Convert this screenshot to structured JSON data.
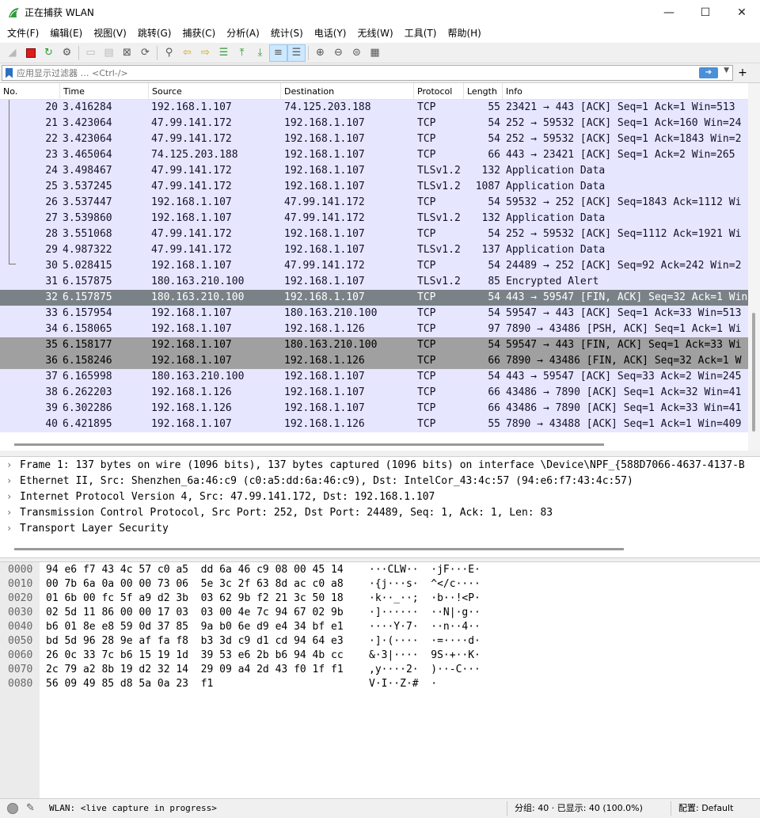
{
  "window": {
    "title": "正在捕获 WLAN",
    "minimize": "—",
    "maximize": "☐",
    "close": "✕"
  },
  "menu": [
    "文件(F)",
    "编辑(E)",
    "视图(V)",
    "跳转(G)",
    "捕获(C)",
    "分析(A)",
    "统计(S)",
    "电话(Y)",
    "无线(W)",
    "工具(T)",
    "帮助(H)"
  ],
  "toolbar": {
    "icons": [
      "start-capture-icon",
      "stop-capture-icon",
      "restart-capture-icon",
      "capture-options-icon",
      "open-file-icon",
      "save-file-icon",
      "close-file-icon",
      "reload-icon",
      "find-packet-icon",
      "go-back-icon",
      "go-forward-icon",
      "go-to-packet-icon",
      "first-packet-icon",
      "last-packet-icon",
      "auto-scroll-icon",
      "colorize-icon",
      "zoom-in-icon",
      "zoom-out-icon",
      "normal-size-icon",
      "resize-columns-icon"
    ]
  },
  "filter": {
    "placeholder": "应用显示过滤器 … <Ctrl-/>",
    "add": "+"
  },
  "packet_list": {
    "columns": [
      "No.",
      "Time",
      "Source",
      "Destination",
      "Protocol",
      "Length",
      "Info"
    ],
    "rows": [
      {
        "no": "20",
        "time": "3.416284",
        "src": "192.168.1.107",
        "dst": "74.125.203.188",
        "proto": "TCP",
        "len": "55",
        "info": "23421 → 443 [ACK] Seq=1 Ack=1 Win=513",
        "style": "normal"
      },
      {
        "no": "21",
        "time": "3.423064",
        "src": "47.99.141.172",
        "dst": "192.168.1.107",
        "proto": "TCP",
        "len": "54",
        "info": "252 → 59532 [ACK] Seq=1 Ack=160 Win=24",
        "style": "normal"
      },
      {
        "no": "22",
        "time": "3.423064",
        "src": "47.99.141.172",
        "dst": "192.168.1.107",
        "proto": "TCP",
        "len": "54",
        "info": "252 → 59532 [ACK] Seq=1 Ack=1843 Win=2",
        "style": "normal"
      },
      {
        "no": "23",
        "time": "3.465064",
        "src": "74.125.203.188",
        "dst": "192.168.1.107",
        "proto": "TCP",
        "len": "66",
        "info": "443 → 23421 [ACK] Seq=1 Ack=2 Win=265",
        "style": "normal"
      },
      {
        "no": "24",
        "time": "3.498467",
        "src": "47.99.141.172",
        "dst": "192.168.1.107",
        "proto": "TLSv1.2",
        "len": "132",
        "info": "Application Data",
        "style": "normal"
      },
      {
        "no": "25",
        "time": "3.537245",
        "src": "47.99.141.172",
        "dst": "192.168.1.107",
        "proto": "TLSv1.2",
        "len": "1087",
        "info": "Application Data",
        "style": "normal"
      },
      {
        "no": "26",
        "time": "3.537447",
        "src": "192.168.1.107",
        "dst": "47.99.141.172",
        "proto": "TCP",
        "len": "54",
        "info": "59532 → 252 [ACK] Seq=1843 Ack=1112 Wi",
        "style": "normal"
      },
      {
        "no": "27",
        "time": "3.539860",
        "src": "192.168.1.107",
        "dst": "47.99.141.172",
        "proto": "TLSv1.2",
        "len": "132",
        "info": "Application Data",
        "style": "normal"
      },
      {
        "no": "28",
        "time": "3.551068",
        "src": "47.99.141.172",
        "dst": "192.168.1.107",
        "proto": "TCP",
        "len": "54",
        "info": "252 → 59532 [ACK] Seq=1112 Ack=1921 Wi",
        "style": "normal"
      },
      {
        "no": "29",
        "time": "4.987322",
        "src": "47.99.141.172",
        "dst": "192.168.1.107",
        "proto": "TLSv1.2",
        "len": "137",
        "info": "Application Data",
        "style": "normal"
      },
      {
        "no": "30",
        "time": "5.028415",
        "src": "192.168.1.107",
        "dst": "47.99.141.172",
        "proto": "TCP",
        "len": "54",
        "info": "24489 → 252 [ACK] Seq=92 Ack=242 Win=2",
        "style": "normal"
      },
      {
        "no": "31",
        "time": "6.157875",
        "src": "180.163.210.100",
        "dst": "192.168.1.107",
        "proto": "TLSv1.2",
        "len": "85",
        "info": "Encrypted Alert",
        "style": "normal"
      },
      {
        "no": "32",
        "time": "6.157875",
        "src": "180.163.210.100",
        "dst": "192.168.1.107",
        "proto": "TCP",
        "len": "54",
        "info": "443 → 59547 [FIN, ACK] Seq=32 Ack=1 Win",
        "style": "fin1"
      },
      {
        "no": "33",
        "time": "6.157954",
        "src": "192.168.1.107",
        "dst": "180.163.210.100",
        "proto": "TCP",
        "len": "54",
        "info": "59547 → 443 [ACK] Seq=1 Ack=33 Win=513",
        "style": "normal"
      },
      {
        "no": "34",
        "time": "6.158065",
        "src": "192.168.1.107",
        "dst": "192.168.1.126",
        "proto": "TCP",
        "len": "97",
        "info": "7890 → 43486 [PSH, ACK] Seq=1 Ack=1 Wi",
        "style": "normal"
      },
      {
        "no": "35",
        "time": "6.158177",
        "src": "192.168.1.107",
        "dst": "180.163.210.100",
        "proto": "TCP",
        "len": "54",
        "info": "59547 → 443 [FIN, ACK] Seq=1 Ack=33 Wi",
        "style": "fin2"
      },
      {
        "no": "36",
        "time": "6.158246",
        "src": "192.168.1.107",
        "dst": "192.168.1.126",
        "proto": "TCP",
        "len": "66",
        "info": "7890 → 43486 [FIN, ACK] Seq=32 Ack=1 W",
        "style": "fin2"
      },
      {
        "no": "37",
        "time": "6.165998",
        "src": "180.163.210.100",
        "dst": "192.168.1.107",
        "proto": "TCP",
        "len": "54",
        "info": "443 → 59547 [ACK] Seq=33 Ack=2 Win=245",
        "style": "normal"
      },
      {
        "no": "38",
        "time": "6.262203",
        "src": "192.168.1.126",
        "dst": "192.168.1.107",
        "proto": "TCP",
        "len": "66",
        "info": "43486 → 7890 [ACK] Seq=1 Ack=32 Win=41",
        "style": "normal"
      },
      {
        "no": "39",
        "time": "6.302286",
        "src": "192.168.1.126",
        "dst": "192.168.1.107",
        "proto": "TCP",
        "len": "66",
        "info": "43486 → 7890 [ACK] Seq=1 Ack=33 Win=41",
        "style": "normal"
      },
      {
        "no": "40",
        "time": "6.421895",
        "src": "192.168.1.107",
        "dst": "192.168.1.126",
        "proto": "TCP",
        "len": "55",
        "info": "7890 → 43488 [ACK] Seq=1 Ack=1 Win=409",
        "style": "normal"
      }
    ]
  },
  "colors": {
    "normal_bg": "#e7e6ff",
    "normal_fg": "#12122a",
    "fin1_bg": "#7a8288",
    "fin1_fg": "#ffffff",
    "fin2_bg": "#a0a0a0",
    "fin2_fg": "#000000"
  },
  "details": [
    "Frame 1: 137 bytes on wire (1096 bits), 137 bytes captured (1096 bits) on interface \\Device\\NPF_{588D7066-4637-4137-B",
    "Ethernet II, Src: Shenzhen_6a:46:c9 (c0:a5:dd:6a:46:c9), Dst: IntelCor_43:4c:57 (94:e6:f7:43:4c:57)",
    "Internet Protocol Version 4, Src: 47.99.141.172, Dst: 192.168.1.107",
    "Transmission Control Protocol, Src Port: 252, Dst Port: 24489, Seq: 1, Ack: 1, Len: 83",
    "Transport Layer Security"
  ],
  "bytes": [
    {
      "off": "0000",
      "hex": "94 e6 f7 43 4c 57 c0 a5  dd 6a 46 c9 08 00 45 14",
      "ascii": "···CLW··  ·jF···E·"
    },
    {
      "off": "0010",
      "hex": "00 7b 6a 0a 00 00 73 06  5e 3c 2f 63 8d ac c0 a8",
      "ascii": "·{j···s·  ^</c····"
    },
    {
      "off": "0020",
      "hex": "01 6b 00 fc 5f a9 d2 3b  03 62 9b f2 21 3c 50 18",
      "ascii": "·k··_··;  ·b··!<P·"
    },
    {
      "off": "0030",
      "hex": "02 5d 11 86 00 00 17 03  03 00 4e 7c 94 67 02 9b",
      "ascii": "·]······  ··N|·g··"
    },
    {
      "off": "0040",
      "hex": "b6 01 8e e8 59 0d 37 85  9a b0 6e d9 e4 34 bf e1",
      "ascii": "····Y·7·  ··n··4··"
    },
    {
      "off": "0050",
      "hex": "bd 5d 96 28 9e af fa f8  b3 3d c9 d1 cd 94 64 e3",
      "ascii": "·]·(····  ·=····d·"
    },
    {
      "off": "0060",
      "hex": "26 0c 33 7c b6 15 19 1d  39 53 e6 2b b6 94 4b cc",
      "ascii": "&·3|····  9S·+··K·"
    },
    {
      "off": "0070",
      "hex": "2c 79 a2 8b 19 d2 32 14  29 09 a4 2d 43 f0 1f f1",
      "ascii": ",y····2·  )··-C···"
    },
    {
      "off": "0080",
      "hex": "56 09 49 85 d8 5a 0a 23  f1",
      "ascii": "V·I··Z·#  ·"
    }
  ],
  "status": {
    "capture": "WLAN: <live capture in progress>",
    "packets": "分组: 40 · 已显示: 40 (100.0%)",
    "profile": "配置: Default"
  }
}
